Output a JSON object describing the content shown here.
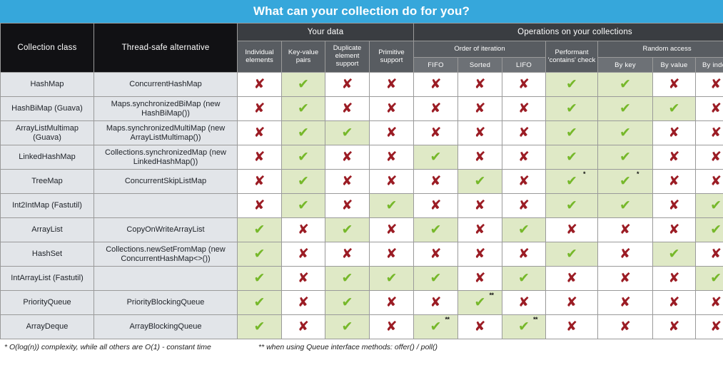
{
  "title": "What can your collection do for you?",
  "header": {
    "col_collection_class": "Collection class",
    "col_thread_safe": "Thread-safe alternative",
    "group_your_data": "Your data",
    "group_operations": "Operations on your collections",
    "sub_individual": "Individual elements",
    "sub_keyvalue": "Key-value pairs",
    "sub_duplicate": "Duplicate element support",
    "sub_primitive": "Primitive support",
    "sub_order": "Order of iteration",
    "sub_fifo": "FIFO",
    "sub_sorted": "Sorted",
    "sub_lifo": "LIFO",
    "sub_contains": "Performant 'contains' check",
    "sub_random": "Random access",
    "sub_bykey": "By key",
    "sub_byvalue": "By value",
    "sub_byindex": "By index"
  },
  "footnotes": {
    "a": "* O(log(n)) complexity, while all others are O(1) - constant time",
    "b": "** when using Queue interface methods: offer() / poll()"
  },
  "colors": {
    "banner": "#36A7DB",
    "header_dark": "#111114",
    "header_group": "#3a3d41",
    "header_sub": "#585c61",
    "header_sub2": "#6d7176",
    "row_label_bg": "#e2e5e9",
    "yes_bg": "#dfe9c6",
    "check": "#76b82a",
    "cross": "#9b1c24"
  },
  "glyphs": {
    "check": "✔",
    "cross": "✘"
  },
  "chart_data": {
    "type": "table",
    "title": "What can your collection do for you?",
    "columns": [
      "Collection class",
      "Thread-safe alternative",
      "Individual elements",
      "Key-value pairs",
      "Duplicate element support",
      "Primitive support",
      "FIFO",
      "Sorted",
      "LIFO",
      "Performant 'contains' check",
      "By key",
      "By value",
      "By index"
    ],
    "column_groups": [
      {
        "label": "Your data",
        "columns": [
          "Individual elements",
          "Key-value pairs",
          "Duplicate element support",
          "Primitive support"
        ]
      },
      {
        "label": "Operations on your collections",
        "columns": [
          "FIFO",
          "Sorted",
          "LIFO",
          "Performant 'contains' check",
          "By key",
          "By value",
          "By index"
        ]
      }
    ],
    "rows": [
      {
        "name": "HashMap",
        "alt": "ConcurrentHashMap",
        "values": [
          "no",
          "yes",
          "no",
          "no",
          "no",
          "no",
          "no",
          "yes",
          "yes",
          "no",
          "no"
        ],
        "marks": [
          "",
          "",
          "",
          "",
          "",
          "",
          "",
          "",
          "",
          "",
          ""
        ]
      },
      {
        "name": "HashBiMap (Guava)",
        "alt": "Maps.synchronizedBiMap (new HashBiMap())",
        "values": [
          "no",
          "yes",
          "no",
          "no",
          "no",
          "no",
          "no",
          "yes",
          "yes",
          "yes",
          "no"
        ],
        "marks": [
          "",
          "",
          "",
          "",
          "",
          "",
          "",
          "",
          "",
          "",
          ""
        ]
      },
      {
        "name": "ArrayListMultimap (Guava)",
        "alt": "Maps.synchronizedMultiMap (new ArrayListMultimap())",
        "values": [
          "no",
          "yes",
          "yes",
          "no",
          "no",
          "no",
          "no",
          "yes",
          "yes",
          "no",
          "no"
        ],
        "marks": [
          "",
          "",
          "",
          "",
          "",
          "",
          "",
          "",
          "",
          "",
          ""
        ]
      },
      {
        "name": "LinkedHashMap",
        "alt": "Collections.synchronizedMap (new LinkedHashMap())",
        "values": [
          "no",
          "yes",
          "no",
          "no",
          "yes",
          "no",
          "no",
          "yes",
          "yes",
          "no",
          "no"
        ],
        "marks": [
          "",
          "",
          "",
          "",
          "",
          "",
          "",
          "",
          "",
          "",
          ""
        ]
      },
      {
        "name": "TreeMap",
        "alt": "ConcurrentSkipListMap",
        "values": [
          "no",
          "yes",
          "no",
          "no",
          "no",
          "yes",
          "no",
          "yes",
          "yes",
          "no",
          "no"
        ],
        "marks": [
          "",
          "",
          "",
          "",
          "",
          "",
          "",
          "*",
          "*",
          "",
          ""
        ]
      },
      {
        "name": "Int2IntMap (Fastutil)",
        "alt": "",
        "values": [
          "no",
          "yes",
          "no",
          "yes",
          "no",
          "no",
          "no",
          "yes",
          "yes",
          "no",
          "yes"
        ],
        "marks": [
          "",
          "",
          "",
          "",
          "",
          "",
          "",
          "",
          "",
          "",
          ""
        ]
      },
      {
        "name": "ArrayList",
        "alt": "CopyOnWriteArrayList",
        "values": [
          "yes",
          "no",
          "yes",
          "no",
          "yes",
          "no",
          "yes",
          "no",
          "no",
          "no",
          "yes"
        ],
        "marks": [
          "",
          "",
          "",
          "",
          "",
          "",
          "",
          "",
          "",
          "",
          ""
        ]
      },
      {
        "name": "HashSet",
        "alt": "Collections.newSetFromMap (new ConcurrentHashMap<>())",
        "values": [
          "yes",
          "no",
          "no",
          "no",
          "no",
          "no",
          "no",
          "yes",
          "no",
          "yes",
          "no"
        ],
        "marks": [
          "",
          "",
          "",
          "",
          "",
          "",
          "",
          "",
          "",
          "",
          ""
        ]
      },
      {
        "name": "IntArrayList (Fastutil)",
        "alt": "",
        "values": [
          "yes",
          "no",
          "yes",
          "yes",
          "yes",
          "no",
          "yes",
          "no",
          "no",
          "no",
          "yes"
        ],
        "marks": [
          "",
          "",
          "",
          "",
          "",
          "",
          "",
          "",
          "",
          "",
          ""
        ]
      },
      {
        "name": "PriorityQueue",
        "alt": "PriorityBlockingQueue",
        "values": [
          "yes",
          "no",
          "yes",
          "no",
          "no",
          "yes",
          "no",
          "no",
          "no",
          "no",
          "no"
        ],
        "marks": [
          "",
          "",
          "",
          "",
          "",
          "**",
          "",
          "",
          "",
          "",
          ""
        ]
      },
      {
        "name": "ArrayDeque",
        "alt": "ArrayBlockingQueue",
        "values": [
          "yes",
          "no",
          "yes",
          "no",
          "yes",
          "no",
          "yes",
          "no",
          "no",
          "no",
          "no"
        ],
        "marks": [
          "",
          "",
          "",
          "",
          "**",
          "",
          "**",
          "",
          "",
          "",
          ""
        ]
      }
    ]
  }
}
